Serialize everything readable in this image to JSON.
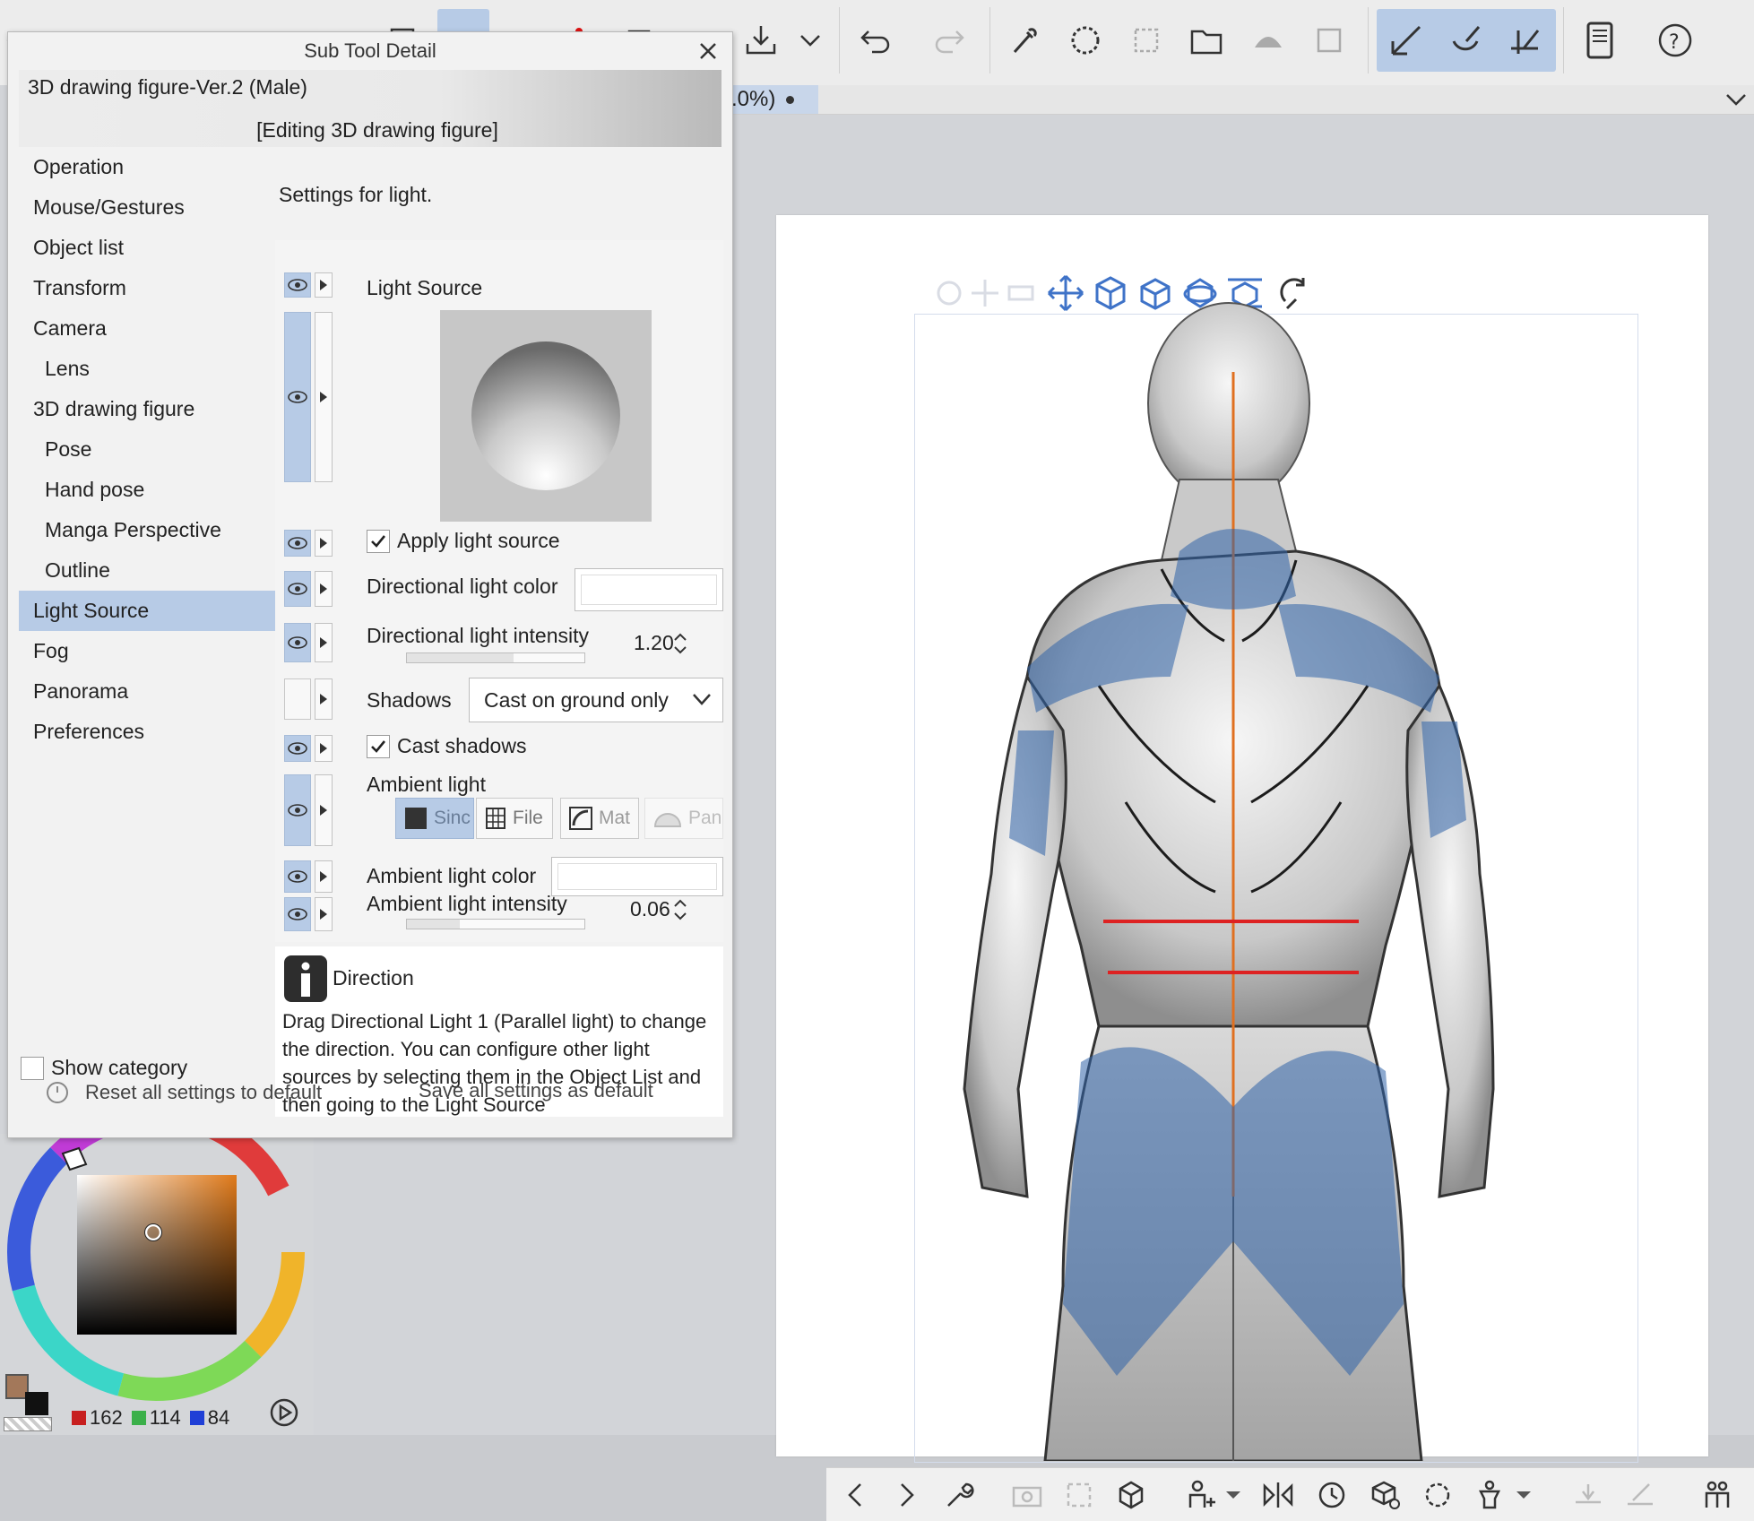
{
  "panel": {
    "title": "Sub Tool Detail",
    "tool_name": "3D drawing figure-Ver.2 (Male)",
    "tool_mode": "[Editing 3D drawing figure]",
    "settings_heading": "Settings for light.",
    "categories": [
      {
        "label": "Operation"
      },
      {
        "label": "Mouse/Gestures"
      },
      {
        "label": "Object list"
      },
      {
        "label": "Transform"
      },
      {
        "label": "Camera"
      },
      {
        "label": "Lens"
      },
      {
        "label": "3D drawing figure"
      },
      {
        "label": "Pose"
      },
      {
        "label": "Hand pose"
      },
      {
        "label": "Manga Perspective"
      },
      {
        "label": "Outline"
      },
      {
        "label": "Light Source"
      },
      {
        "label": "Fog"
      },
      {
        "label": "Panorama"
      },
      {
        "label": "Preferences"
      }
    ],
    "active_category": "Light Source",
    "show_category_label": "Show category",
    "show_category_checked": false,
    "properties": {
      "light_source_label": "Light Source",
      "apply_light_label": "Apply light source",
      "apply_light_checked": true,
      "dir_color_label": "Directional light color",
      "dir_color_value": "#ffffff",
      "dir_intensity_label": "Directional light intensity",
      "dir_intensity_value": "1.20",
      "shadows_label": "Shadows",
      "shadows_value": "Cast on ground only",
      "cast_shadows_label": "Cast shadows",
      "cast_shadows_checked": true,
      "ambient_label": "Ambient light",
      "ambient_modes": [
        "Sinc",
        "File",
        "Mat",
        "Pan"
      ],
      "ambient_color_label": "Ambient light color",
      "ambient_color_value": "#ffffff",
      "ambient_intensity_label": "Ambient light intensity",
      "ambient_intensity_value": "0.06"
    },
    "info": {
      "title": "Direction",
      "text": "Drag Directional Light 1 (Parallel light) to change the direction. You can configure other light sources by selecting them in the Object List and then going to the Light Source"
    },
    "footer": {
      "reset_label": "Reset all settings to default",
      "save_label": "Save all settings as default"
    }
  },
  "document_tab": {
    "zoom_fragment": ".0%)"
  },
  "toolbar_icons": [
    "menu-icon",
    "new-canvas-icon",
    "brush-icon",
    "layer-properties-icon",
    "open-icon",
    "export-icon",
    "import-icon",
    "undo-icon",
    "redo-icon",
    "eyedropper-icon",
    "lasso-select-icon",
    "select-all-icon",
    "folder-icon",
    "fill-icon",
    "crop-icon",
    "pen-icon",
    "brush-stroke-icon",
    "ruler-icon",
    "page-icon",
    "help-icon"
  ],
  "canvas_bottom_icons": [
    "prev-icon",
    "next-icon",
    "wrench-icon",
    "camera-icon",
    "fit-icon",
    "3d-object-icon",
    "figure-icon",
    "mirror-icon",
    "pose-history-icon",
    "3d-cube-icon",
    "rotate-icon",
    "body-shape-icon",
    "floor-icon",
    "brush-ground-icon",
    "character-icon"
  ],
  "color": {
    "main": "#a3785a",
    "sub": "#111111",
    "r": "162",
    "g": "114",
    "b": "84",
    "accent": "#b7cbe6"
  }
}
